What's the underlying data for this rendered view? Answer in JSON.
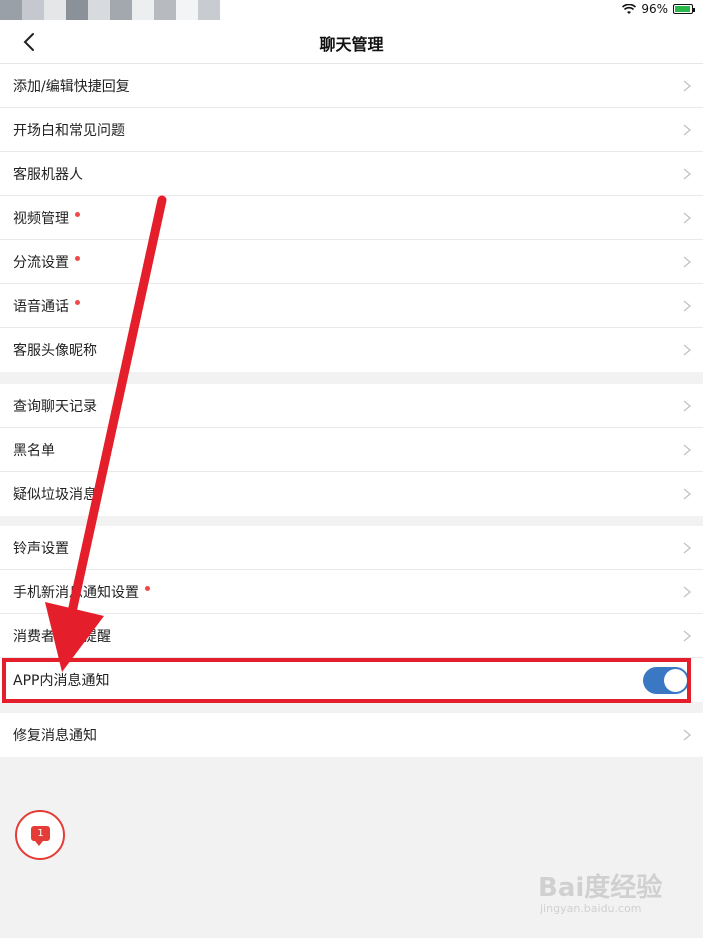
{
  "status_bar": {
    "battery_percent": "96%",
    "battery_level": 0.96,
    "wifi_icon": "wifi-icon"
  },
  "nav": {
    "title": "聊天管理",
    "back_icon": "chevron-left-icon"
  },
  "groups": [
    {
      "items": [
        {
          "label": "添加/编辑快捷回复",
          "dot": false
        },
        {
          "label": "开场白和常见问题",
          "dot": false
        },
        {
          "label": "客服机器人",
          "dot": false
        },
        {
          "label": "视频管理",
          "dot": true
        },
        {
          "label": "分流设置",
          "dot": true
        },
        {
          "label": "语音通话",
          "dot": true
        },
        {
          "label": "客服头像昵称",
          "dot": false
        }
      ]
    },
    {
      "items": [
        {
          "label": "查询聊天记录",
          "dot": false
        },
        {
          "label": "黑名单",
          "dot": false
        },
        {
          "label": "疑似垃圾消息",
          "dot": false
        }
      ]
    },
    {
      "items": [
        {
          "label": "铃声设置",
          "dot": false
        },
        {
          "label": "手机新消息通知设置",
          "dot": true
        },
        {
          "label": "消费者留言提醒",
          "dot": false
        },
        {
          "label": "APP内消息通知",
          "toggle": true,
          "toggle_on": true
        }
      ]
    },
    {
      "items": [
        {
          "label": "修复消息通知",
          "dot": false
        }
      ]
    }
  ],
  "float_button": {
    "badge": "1",
    "icon": "chat-bubble-icon"
  },
  "watermark": {
    "text": "Bai度经验",
    "url": "jingyan.baidu.com"
  },
  "colors": {
    "accent_red": "#e41e2a",
    "toggle_blue": "#3a78c4",
    "dot_red": "#f04848"
  }
}
